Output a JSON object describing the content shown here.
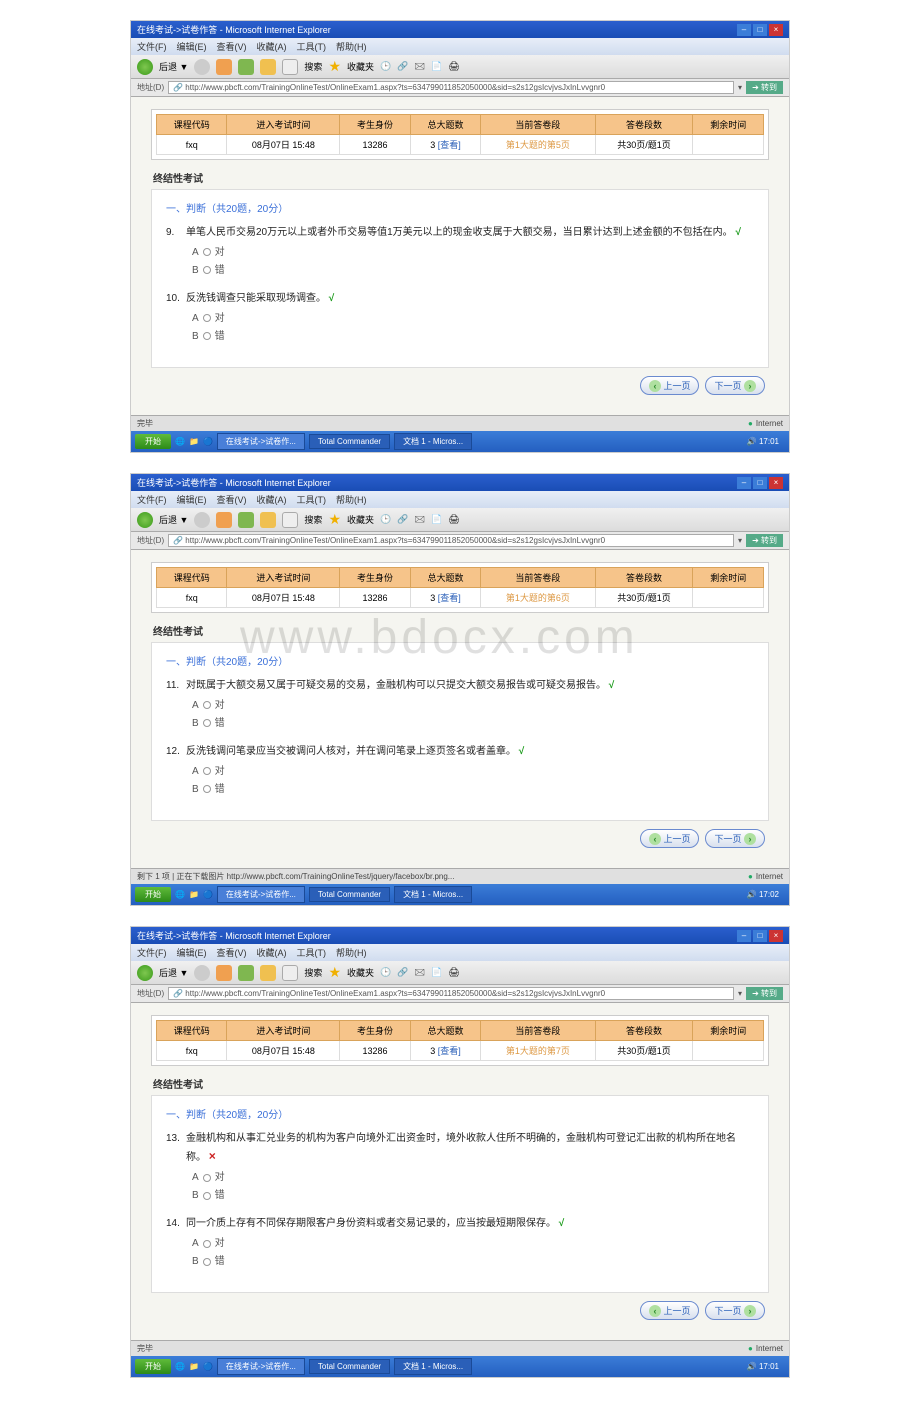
{
  "watermark": "www.bdocx.com",
  "ie": {
    "title": "在线考试->试卷作答 - Microsoft Internet Explorer",
    "menu": {
      "file": "文件(F)",
      "edit": "编辑(E)",
      "view": "查看(V)",
      "fav": "收藏(A)",
      "tools": "工具(T)",
      "help": "帮助(H)"
    },
    "toolbar": {
      "back": "后退",
      "search": "搜索",
      "fav": "收藏夹"
    },
    "address_label": "地址(D)",
    "url": "http://www.pbcft.com/TrainingOnlineTest/OnlineExam1.aspx?ts=634799011852050000&sid=s2s12gsIcvjvsJxInLvvgnr0",
    "go": "转到",
    "status_done": "完毕",
    "status_remain": "剩下 1 项 | 正在下载图片 http://www.pbcft.com/TrainingOnlineTest/jquery/facebox/br.png...",
    "internet": "Internet"
  },
  "taskbar": {
    "start": "开始",
    "tasks": {
      "exam": "在线考试->试卷作...",
      "tc": "Total Commander",
      "wp": "文档 1 - Micros..."
    },
    "time1": "17:01",
    "time2": "17:02",
    "time3": "17:01"
  },
  "header": {
    "cols": {
      "code": "课程代码",
      "time": "进入考试时间",
      "id": "考生身份",
      "total": "总大题数",
      "current": "当前答卷段",
      "pages": "答卷段数",
      "remain": "剩余时间"
    },
    "vals": {
      "code": "fxq",
      "time": "08月07日 15:48",
      "id": "13286",
      "total_num": "3",
      "total_link": "[查看]",
      "current": "第1大题的第5页",
      "pages": "共30页/题1页",
      "remain": ""
    },
    "exam_name": "终结性考试"
  },
  "section": {
    "title": "一、判断（共20题，20分）"
  },
  "nav": {
    "prev": "上一页",
    "next": "下一页"
  },
  "screens": [
    {
      "current_page": "第1大题的第5页",
      "questions": [
        {
          "num": "9.",
          "text": "单笔人民币交易20万元以上或者外币交易等值1万美元以上的现金收支属于大额交易，当日累计达到上述金额的不包括在内。",
          "mark": "√",
          "mark_class": "mark-correct",
          "opts": {
            "a": "A",
            "a_txt": "对",
            "b": "B",
            "b_txt": "错"
          }
        },
        {
          "num": "10.",
          "text": "反洗钱调查只能采取现场调查。",
          "mark": "√",
          "mark_class": "mark-correct",
          "opts": {
            "a": "A",
            "a_txt": "对",
            "b": "B",
            "b_txt": "错"
          }
        }
      ],
      "status_key": "status_done",
      "time_key": "time1"
    },
    {
      "current_page": "第1大题的第6页",
      "questions": [
        {
          "num": "11.",
          "text": "对既属于大额交易又属于可疑交易的交易，金融机构可以只提交大额交易报告或可疑交易报告。",
          "mark": "√",
          "mark_class": "mark-correct",
          "opts": {
            "a": "A",
            "a_txt": "对",
            "b": "B",
            "b_txt": "错"
          }
        },
        {
          "num": "12.",
          "text": "反洗钱调问笔录应当交被调问人核对，并在调问笔录上逐页签名或者盖章。",
          "mark": "√",
          "mark_class": "mark-correct",
          "opts": {
            "a": "A",
            "a_txt": "对",
            "b": "B",
            "b_txt": "错"
          }
        }
      ],
      "status_key": "status_remain",
      "time_key": "time2"
    },
    {
      "current_page": "第1大题的第7页",
      "questions": [
        {
          "num": "13.",
          "text": "金融机构和从事汇兑业务的机构为客户向境外汇出资金时，境外收款人住所不明确的，金融机构可登记汇出款的机构所在地名称。",
          "mark": "×",
          "mark_class": "mark-wrong",
          "opts": {
            "a": "A",
            "a_txt": "对",
            "b": "B",
            "b_txt": "错"
          }
        },
        {
          "num": "14.",
          "text": "同一介质上存有不同保存期限客户身份资料或者交易记录的，应当按最短期限保存。",
          "mark": "√",
          "mark_class": "mark-correct",
          "opts": {
            "a": "A",
            "a_txt": "对",
            "b": "B",
            "b_txt": "错"
          }
        }
      ],
      "status_key": "status_done",
      "time_key": "time3"
    }
  ]
}
